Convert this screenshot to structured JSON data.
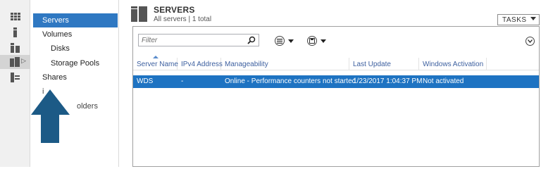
{
  "nav": {
    "items": [
      {
        "label": "Servers"
      },
      {
        "label": "Volumes"
      },
      {
        "label": "Disks"
      },
      {
        "label": "Storage Pools"
      },
      {
        "label": "Shares"
      },
      {
        "label": "i"
      },
      {
        "label": "olders"
      }
    ]
  },
  "header": {
    "title": "SERVERS",
    "subtitle": "All servers | 1 total",
    "tasks_label": "TASKS"
  },
  "filter": {
    "placeholder": "Filter"
  },
  "table": {
    "columns": [
      "Server Name",
      "IPv4 Address",
      "Manageability",
      "Last Update",
      "Windows Activation"
    ],
    "rows": [
      {
        "server_name": "WDS",
        "ipv4": "-",
        "manageability": "Online - Performance counters not started",
        "last_update": "1/23/2017 1:04:37 PM",
        "activation": "Not activated"
      }
    ]
  },
  "colors": {
    "selection": "#2f78c2",
    "arrow": "#1c5a86",
    "header_link": "#3c5f9f"
  }
}
